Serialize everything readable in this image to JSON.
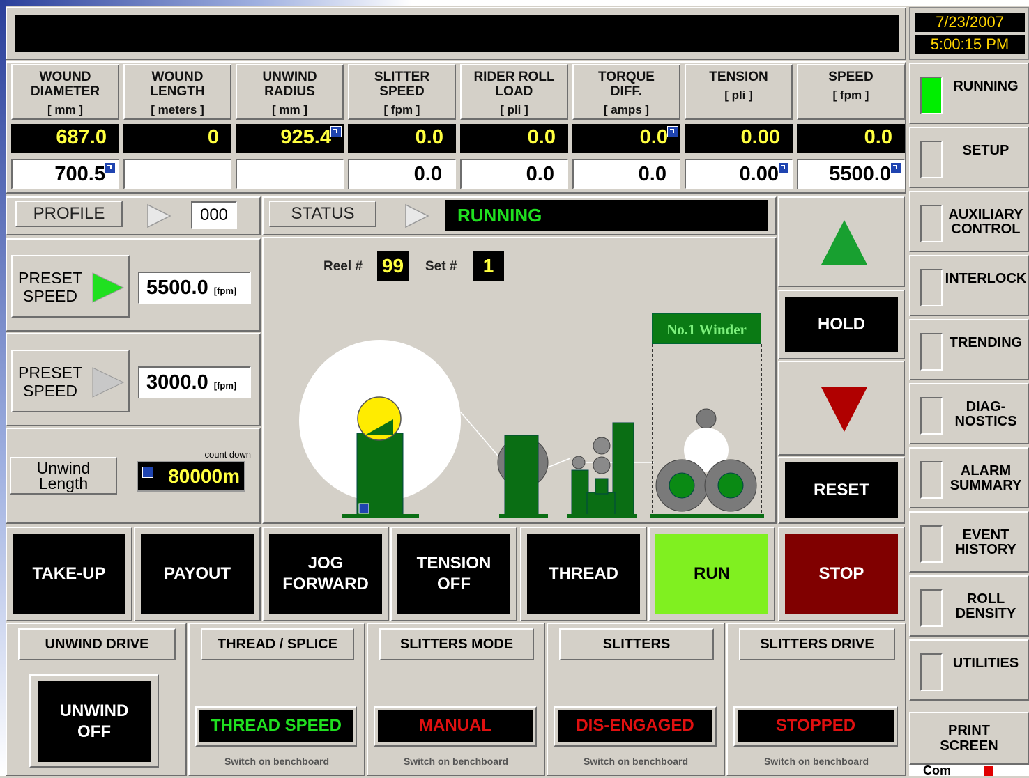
{
  "datetime": {
    "date": "7/23/2007",
    "time": "5:00:15 PM"
  },
  "columns": [
    {
      "label": "WOUND\nDIAMETER",
      "unit": "[ mm ]",
      "actual": "687.0",
      "setpoint": "700.5",
      "actual_link": false,
      "setpoint_link": true
    },
    {
      "label": "WOUND\nLENGTH",
      "unit": "[ meters ]",
      "actual": "0",
      "setpoint": "",
      "actual_link": false,
      "setpoint_link": false
    },
    {
      "label": "UNWIND\nRADIUS",
      "unit": "[ mm ]",
      "actual": "925.4",
      "setpoint": "",
      "actual_link": true,
      "setpoint_link": false
    },
    {
      "label": "SLITTER\nSPEED",
      "unit": "[ fpm ]",
      "actual": "0.0",
      "setpoint": "0.0",
      "actual_link": false,
      "setpoint_link": false
    },
    {
      "label": "RIDER ROLL\nLOAD",
      "unit": "[ pli ]",
      "actual": "0.0",
      "setpoint": "0.0",
      "actual_link": false,
      "setpoint_link": false
    },
    {
      "label": "TORQUE\nDIFF.",
      "unit": "[ amps ]",
      "actual": "0.0",
      "setpoint": "0.0",
      "actual_link": true,
      "setpoint_link": false
    },
    {
      "label": "TENSION",
      "unit": "[ pli ]",
      "actual": "0.00",
      "setpoint": "0.00",
      "actual_link": false,
      "setpoint_link": true
    },
    {
      "label": "SPEED",
      "unit": "[ fpm ]",
      "actual": "0.0",
      "setpoint": "5500.0",
      "actual_link": false,
      "setpoint_link": true
    }
  ],
  "profile": {
    "label": "PROFILE",
    "value": "000"
  },
  "status": {
    "label": "STATUS",
    "value": "RUNNING"
  },
  "presets": [
    {
      "label": "PRESET\nSPEED",
      "value": "5500.0",
      "unit": "[fpm]",
      "active": true
    },
    {
      "label": "PRESET\nSPEED",
      "value": "3000.0",
      "unit": "[fpm]",
      "active": false
    }
  ],
  "unwind_length": {
    "label": "Unwind\nLength",
    "caption": "count down",
    "value": "80000",
    "unit": "m"
  },
  "graphic": {
    "reel_label": "Reel #",
    "reel_value": "99",
    "set_label": "Set #",
    "set_value": "1",
    "winder_label": "No.1 Winder"
  },
  "right_controls": {
    "hold": "HOLD",
    "reset": "RESET"
  },
  "main_buttons": [
    {
      "label": "TAKE-UP",
      "color": "#000000",
      "text_color": "#ffffff"
    },
    {
      "label": "PAYOUT",
      "color": "#000000",
      "text_color": "#ffffff"
    },
    {
      "label": "JOG\nFORWARD",
      "color": "#000000",
      "text_color": "#ffffff"
    },
    {
      "label": "TENSION\nOFF",
      "color": "#000000",
      "text_color": "#ffffff"
    },
    {
      "label": "THREAD",
      "color": "#000000",
      "text_color": "#ffffff"
    },
    {
      "label": "RUN",
      "color": "#80f020",
      "text_color": "#000000"
    },
    {
      "label": "STOP",
      "color": "#800000",
      "text_color": "#ffffff"
    }
  ],
  "groups": [
    {
      "title": "UNWIND DRIVE",
      "button": "UNWIND\nOFF",
      "status": "",
      "status_color": "",
      "note": ""
    },
    {
      "title": "THREAD / SPLICE",
      "button": "",
      "status": "THREAD SPEED",
      "status_color": "#20e020",
      "note": "Switch on benchboard"
    },
    {
      "title": "SLITTERS MODE",
      "button": "",
      "status": "MANUAL",
      "status_color": "#e01010",
      "note": "Switch on benchboard"
    },
    {
      "title": "SLITTERS",
      "button": "",
      "status": "DIS-ENGAGED",
      "status_color": "#e01010",
      "note": "Switch on benchboard"
    },
    {
      "title": "SLITTERS DRIVE",
      "button": "",
      "status": "STOPPED",
      "status_color": "#e01010",
      "note": "Switch on benchboard"
    }
  ],
  "nav": [
    {
      "label": "RUNNING",
      "lamp": "#00ee00",
      "icon": "lamp-on"
    },
    {
      "label": "SETUP",
      "lamp": "#d4d0c8",
      "icon": "lamp-off"
    },
    {
      "label": "AUXILIARY\nCONTROL",
      "lamp": "#d4d0c8",
      "icon": "lamp-off"
    },
    {
      "label": "INTERLOCK",
      "lamp": "#d4d0c8",
      "icon": "lamp-off"
    },
    {
      "label": "TRENDING",
      "lamp": "#d4d0c8",
      "icon": "lamp-off"
    },
    {
      "label": "DIAG-\nNOSTICS",
      "lamp": "#d4d0c8",
      "icon": "lamp-off"
    },
    {
      "label": "ALARM\nSUMMARY",
      "lamp": "#d4d0c8",
      "icon": "lamp-off"
    },
    {
      "label": "EVENT\nHISTORY",
      "lamp": "#d4d0c8",
      "icon": "lamp-off"
    },
    {
      "label": "ROLL\nDENSITY",
      "lamp": "#d4d0c8",
      "icon": "lamp-off"
    },
    {
      "label": "UTILITIES",
      "lamp": "#d4d0c8",
      "icon": "lamp-off"
    }
  ],
  "print_screen": "PRINT\nSCREEN",
  "com_label": "Com",
  "colors": {
    "panel": "#d4d0c8",
    "value_text": "#ffff40",
    "running_green": "#20e020",
    "machine_green": "#0a6e14"
  }
}
